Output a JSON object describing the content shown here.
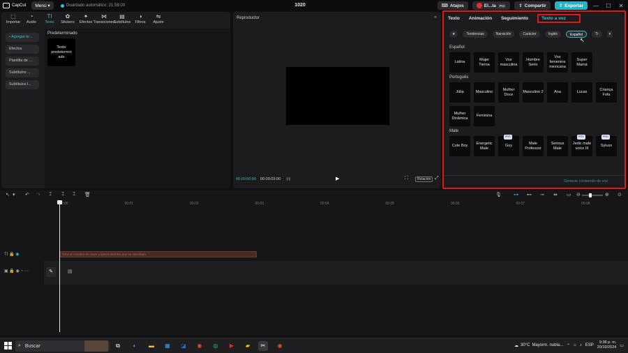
{
  "topbar": {
    "logo_text": "CapCut",
    "menu_label": "Menú",
    "autosave_text": "Guardado automático: 21:58:00",
    "project_title": "1020",
    "shortcuts_label": "Atajos",
    "user_label": "El...la",
    "pro_badge": "Pro",
    "share_label": "Compartir",
    "export_label": "Exportar",
    "minimize": "—",
    "maximize": "☐",
    "close": "✕"
  },
  "media_tabs": [
    {
      "label": "Importar",
      "icon": "⬚"
    },
    {
      "label": "Audio",
      "icon": "◔"
    },
    {
      "label": "Texto",
      "icon": "TI"
    },
    {
      "label": "Stickers",
      "icon": "✿"
    },
    {
      "label": "Efectos",
      "icon": "✦"
    },
    {
      "label": "Transiciones",
      "icon": "⋈"
    },
    {
      "label": "Subtítulos",
      "icon": "▤"
    },
    {
      "label": "Filtros",
      "icon": "◑"
    },
    {
      "label": "Ajuste",
      "icon": "⇋"
    }
  ],
  "text_categories": [
    "• Agregar te...",
    "Efectos",
    "Plantilla de ...",
    "Subtítulos ...",
    "Subtítulos l..."
  ],
  "media": {
    "section_title": "Predeterminado",
    "card_label": "Texto predetermin ado"
  },
  "player": {
    "title": "Reproductor",
    "menu_icon": "≡",
    "current_time": "00:00:00:00",
    "duration": "00:00:03:00",
    "play_icon": "▶",
    "ratio_label": "Relación",
    "fit_icon": "⛶",
    "fullscreen_icon": "⤢"
  },
  "properties": {
    "tabs": [
      "Texto",
      "Animación",
      "Seguimiento",
      "Texto a voz"
    ],
    "active_tab": "Texto a voz",
    "chips": [
      "★",
      "Tendencias",
      "Narración",
      "Carácter",
      "Inglés",
      "Español",
      "Tr",
      "▾"
    ],
    "active_chip": "Español",
    "generate_label": "Generar contenido de voz",
    "sections": [
      {
        "title": "Español",
        "voices": [
          "Latina",
          "Mujer Tierna",
          "Voz masculina",
          "Hombre Serio",
          "Voz femenina mexicana",
          "Super Mamá"
        ]
      },
      {
        "title": "Português",
        "voices": [
          "Júlia",
          "Masculino",
          "Mulher Doce",
          "Masculino 2",
          "Ana",
          "Lucas",
          "Criança Fofa",
          "Mulher Dinâmica",
          "Feminina"
        ]
      },
      {
        "title": "Male",
        "voices": [
          "Cute Boy",
          "Energetic Male",
          "Guy",
          "Male Professor",
          "Serious Male",
          "Jedic male voice III",
          "Syluss"
        ],
        "badge_label": "PRO"
      }
    ]
  },
  "timeline": {
    "ruler": [
      "00:00",
      "00:01",
      "00:02",
      "00:03",
      "00:04",
      "00:05",
      "00:06",
      "00:07",
      "00:08"
    ],
    "text_clip": "Toca un nombre en cines y quería decirles que se suscriban",
    "track_t_label": "TI"
  },
  "taskbar": {
    "search_label": "Buscar",
    "weather_temp": "30°C",
    "weather_desc": "Mayorm. nubla...",
    "lang": "ESP",
    "time": "9:38 p. m.",
    "date": "20/10/2024"
  }
}
